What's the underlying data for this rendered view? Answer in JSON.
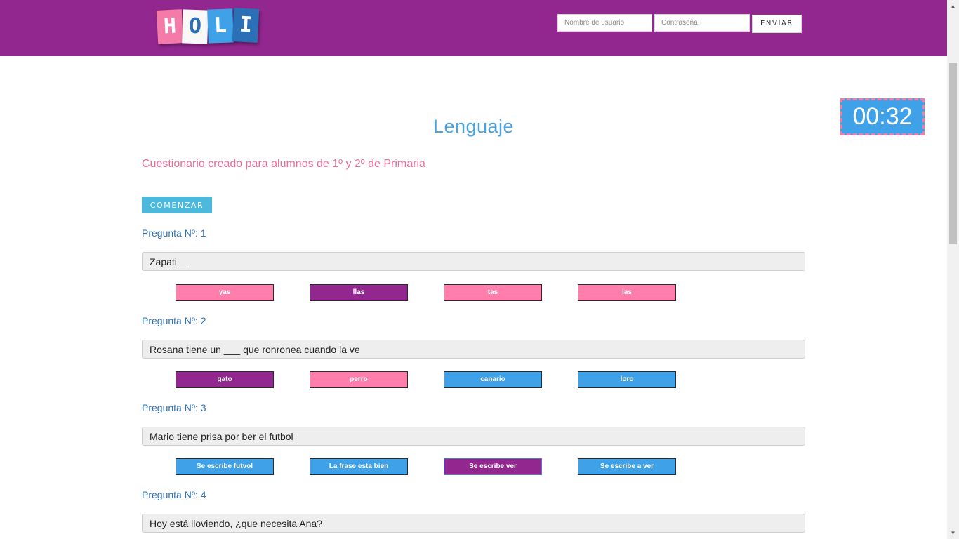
{
  "header": {
    "logo_letters": [
      "H",
      "O",
      "L",
      "I"
    ],
    "username_placeholder": "Nombre de usuario",
    "password_placeholder": "Contraseña",
    "send_label": "ENVIAR",
    "bg_color": "#92278f"
  },
  "timer": {
    "value": "00:32"
  },
  "quiz": {
    "title": "Lenguaje",
    "subtitle": "Cuestionario creado para alumnos de 1º y 2º de Primaria",
    "start_label": "COMENZAR"
  },
  "questions": [
    {
      "label": "Pregunta Nº: 1",
      "text": "Zapati__",
      "options": [
        {
          "label": "yas",
          "color": "pink"
        },
        {
          "label": "llas",
          "color": "purple"
        },
        {
          "label": "tas",
          "color": "pink"
        },
        {
          "label": "las",
          "color": "pink"
        }
      ]
    },
    {
      "label": "Pregunta Nº: 2",
      "text": "Rosana tiene un ___ que ronronea cuando la ve",
      "options": [
        {
          "label": "gato",
          "color": "purple"
        },
        {
          "label": "perro",
          "color": "pink"
        },
        {
          "label": "canario",
          "color": "blue"
        },
        {
          "label": "loro",
          "color": "blue"
        }
      ]
    },
    {
      "label": "Pregunta Nº: 3",
      "text": "Mario tiene prisa por ber el futbol",
      "options": [
        {
          "label": "Se escribe futvol",
          "color": "blue"
        },
        {
          "label": "La frase esta bien",
          "color": "blue"
        },
        {
          "label": "Se escribe ver",
          "color": "purple"
        },
        {
          "label": "Se escribe a ver",
          "color": "blue"
        }
      ]
    },
    {
      "label": "Pregunta Nº: 4",
      "text": "Hoy está lloviendo, ¿que necesita Ana?",
      "options": []
    }
  ],
  "colors": {
    "pink": "#ff7eab",
    "purple": "#92278f",
    "blue": "#3fa2e8",
    "title_blue": "#4aa3df",
    "subtitle_pink": "#e86f9b"
  }
}
